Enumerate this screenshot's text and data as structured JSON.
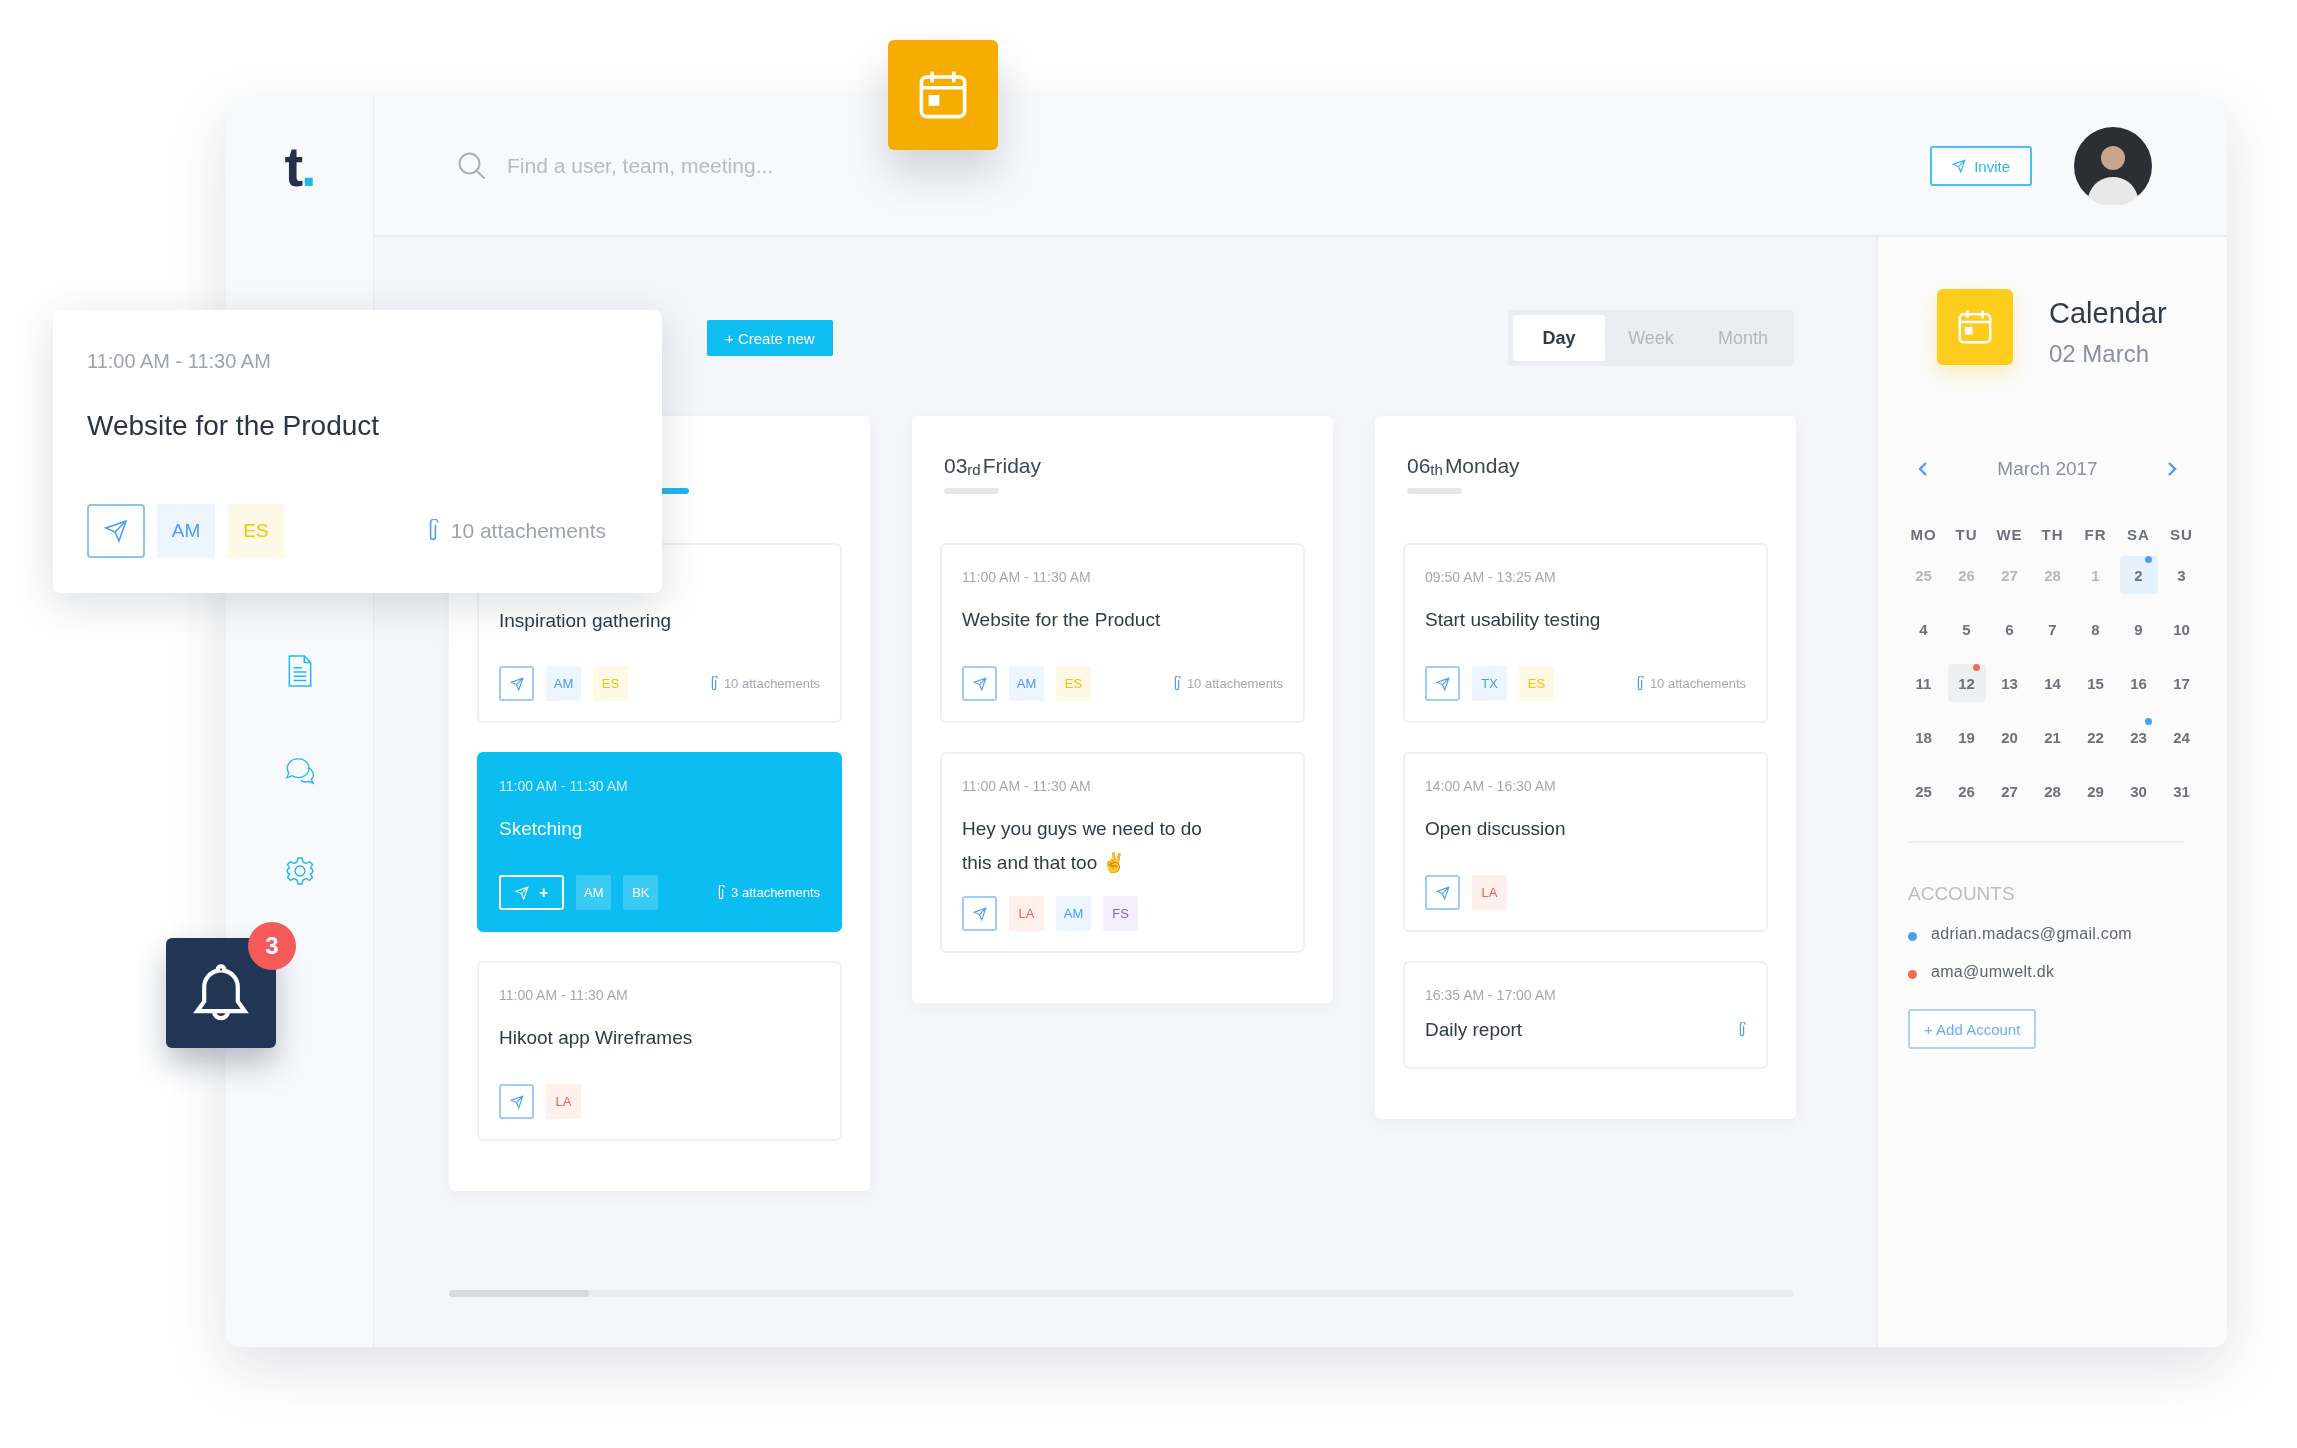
{
  "logo": {
    "letter": "t",
    "mark": "."
  },
  "search": {
    "placeholder": "Find a user, team, meeting..."
  },
  "invite_button": "Invite",
  "create_button": "+ Create new",
  "view_tabs": [
    {
      "label": "Day",
      "selected": true
    },
    {
      "label": "Week",
      "selected": false
    },
    {
      "label": "Month",
      "selected": false
    }
  ],
  "columns": [
    {
      "selected": true,
      "cards": [
        {
          "title": "Inspiration gathering",
          "selected": false,
          "tags": [
            {
              "label": "AM",
              "color": "#4a9df8"
            },
            {
              "label": "ES",
              "color": "#f5c400"
            }
          ],
          "attachment": true,
          "attachments": "10 attachements"
        },
        {
          "time": "11:00 AM - 11:30 AM",
          "title": "Sketching",
          "selected": true,
          "share_label": "+",
          "tags": [
            {
              "label": "AM"
            },
            {
              "label": "BK"
            }
          ],
          "attachment": true,
          "attachments": "3 attachements"
        },
        {
          "time": "11:00 AM - 11:30 AM",
          "title": "Hikoot app Wireframes",
          "selected": false,
          "tags": [
            {
              "label": "LA",
              "color": "#f0644f"
            }
          ],
          "attachment": false
        }
      ]
    },
    {
      "selected": false,
      "heading": {
        "day": "03",
        "suffix": "rd",
        "weekday": "Friday"
      },
      "cards": [
        {
          "time": "11:00 AM - 11:30 AM",
          "title": "Website for the Product",
          "selected": false,
          "tags": [
            {
              "label": "AM",
              "color": "#4a9df8"
            },
            {
              "label": "ES",
              "color": "#f5c400"
            }
          ],
          "attachment": true,
          "attachments": "10 attachements"
        },
        {
          "time": "11:00 AM - 11:30 AM",
          "title": "Hey you guys we need to do this and that too ✌",
          "selected": false,
          "tags": [
            {
              "label": "LA",
              "color": "#f0644f"
            },
            {
              "label": "AM",
              "color": "#4a9df8"
            },
            {
              "label": "FS",
              "color": "#8e5bd8"
            }
          ],
          "attachment": false
        }
      ]
    },
    {
      "selected": false,
      "heading": {
        "day": "06",
        "suffix": "th",
        "weekday": "Monday"
      },
      "cards": [
        {
          "time": "09:50 AM - 13:25 AM",
          "title": "Start usability testing",
          "selected": false,
          "tags": [
            {
              "label": "TX",
              "color": "#4a9df8"
            },
            {
              "label": "ES",
              "color": "#f5c400"
            }
          ],
          "attachment": true,
          "attachments": "10 attachements"
        },
        {
          "time": "14:00 AM - 16:30 AM",
          "title": "Open discussion",
          "selected": false,
          "tags": [
            {
              "label": "LA",
              "color": "#f0644f"
            }
          ],
          "attachment": false
        },
        {
          "kind": "compact",
          "time": "16:35 AM - 17:00 AM",
          "title": "Daily report",
          "selected": false,
          "attachment": true
        }
      ]
    }
  ],
  "popup": {
    "time": "11:00 AM - 11:30 AM",
    "title": "Website for the Product",
    "tags": [
      {
        "label": "AM",
        "color": "#4a9df8"
      },
      {
        "label": "ES",
        "color": "#f5c400"
      }
    ],
    "attachments": "10 attachements"
  },
  "notifications": {
    "count": "3"
  },
  "calendar": {
    "title": "Calendar",
    "date": "02 March",
    "month": "March 2017",
    "weekdays": [
      "MO",
      "TU",
      "WE",
      "TH",
      "FR",
      "SA",
      "SU"
    ],
    "days": [
      {
        "label": "25",
        "muted": true,
        "selected": false,
        "today": false
      },
      {
        "label": "26",
        "muted": true,
        "selected": false,
        "today": false
      },
      {
        "label": "27",
        "muted": true,
        "selected": false,
        "today": false
      },
      {
        "label": "28",
        "muted": true,
        "selected": false,
        "today": false
      },
      {
        "label": "1",
        "muted": true,
        "selected": false,
        "today": false
      },
      {
        "label": "2",
        "muted": false,
        "selected": true,
        "today": false,
        "color": "#4a9df8"
      },
      {
        "label": "3",
        "muted": false,
        "selected": false,
        "today": false
      },
      {
        "label": "4",
        "muted": false,
        "selected": false,
        "today": false
      },
      {
        "label": "5",
        "muted": false,
        "selected": false,
        "today": false
      },
      {
        "label": "6",
        "muted": false,
        "selected": false,
        "today": false
      },
      {
        "label": "7",
        "muted": false,
        "selected": false,
        "today": false
      },
      {
        "label": "8",
        "muted": false,
        "selected": false,
        "today": false
      },
      {
        "label": "9",
        "muted": false,
        "selected": false,
        "today": false
      },
      {
        "label": "10",
        "muted": false,
        "selected": false,
        "today": false
      },
      {
        "label": "11",
        "muted": false,
        "selected": false,
        "today": false
      },
      {
        "label": "12",
        "muted": false,
        "selected": false,
        "today": true,
        "color": "#f26b4f"
      },
      {
        "label": "13",
        "muted": false,
        "selected": false,
        "today": false
      },
      {
        "label": "14",
        "muted": false,
        "selected": false,
        "today": false
      },
      {
        "label": "15",
        "muted": false,
        "selected": false,
        "today": false
      },
      {
        "label": "16",
        "muted": false,
        "selected": false,
        "today": false
      },
      {
        "label": "17",
        "muted": false,
        "selected": false,
        "today": false
      },
      {
        "label": "18",
        "muted": false,
        "selected": false,
        "today": false
      },
      {
        "label": "19",
        "muted": false,
        "selected": false,
        "today": false
      },
      {
        "label": "20",
        "muted": false,
        "selected": false,
        "today": false
      },
      {
        "label": "21",
        "muted": false,
        "selected": false,
        "today": false
      },
      {
        "label": "22",
        "muted": false,
        "selected": false,
        "today": false
      },
      {
        "label": "23",
        "muted": false,
        "selected": false,
        "today": false,
        "color": "#4a9df8"
      },
      {
        "label": "24",
        "muted": false,
        "selected": false,
        "today": false
      },
      {
        "label": "25",
        "muted": false,
        "selected": false,
        "today": false
      },
      {
        "label": "26",
        "muted": false,
        "selected": false,
        "today": false
      },
      {
        "label": "27",
        "muted": false,
        "selected": false,
        "today": false
      },
      {
        "label": "28",
        "muted": false,
        "selected": false,
        "today": false
      },
      {
        "label": "29",
        "muted": false,
        "selected": false,
        "today": false
      },
      {
        "label": "30",
        "muted": false,
        "selected": false,
        "today": false
      },
      {
        "label": "31",
        "muted": false,
        "selected": false,
        "today": false
      }
    ],
    "accounts_heading": "ACCOUNTS",
    "accounts": [
      {
        "email": "adrian.madacs@gmail.com",
        "color": "#4a9df8"
      },
      {
        "email": "ama@umwelt.dk",
        "color": "#f26b4f"
      }
    ],
    "add_account": "+ Add Account"
  }
}
